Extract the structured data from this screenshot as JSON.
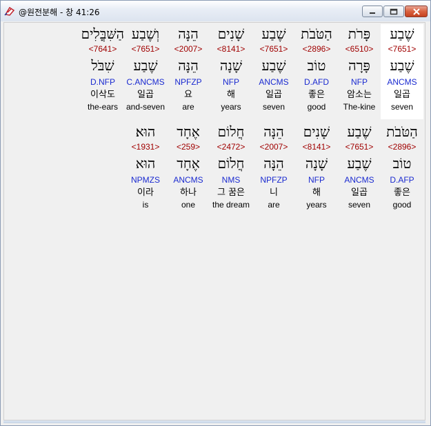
{
  "window": {
    "title": "@원전분해 - 창 41:26"
  },
  "verse": {
    "rows": [
      {
        "cells": [
          {
            "hebrew": "הַשִּׁבֳּלִים",
            "strong": "<7641>",
            "lemma": "שִׁבֹּל",
            "morph": "D.NFP",
            "korean": "이삭도",
            "english": "the-ears"
          },
          {
            "hebrew": "וְשֶׁבַע",
            "strong": "<7651>",
            "lemma": "שֶׁבַע",
            "morph": "C.ANCMS",
            "korean": "일곱",
            "english": "and-seven"
          },
          {
            "hebrew": "הֵנָּה",
            "strong": "<2007>",
            "lemma": "הֵנָּה",
            "morph": "NPFZP",
            "korean": "요",
            "english": "are"
          },
          {
            "hebrew": "שָׁנִים",
            "strong": "<8141>",
            "lemma": "שָׁנָה",
            "morph": "NFP",
            "korean": "해",
            "english": "years"
          },
          {
            "hebrew": "שֶׁבַע",
            "strong": "<7651>",
            "lemma": "שֶׁבַע",
            "morph": "ANCMS",
            "korean": "일곱",
            "english": "seven"
          },
          {
            "hebrew": "הַטֹּבֹת",
            "strong": "<2896>",
            "lemma": "טוֹב",
            "morph": "D.AFD",
            "korean": "좋은",
            "english": "good"
          },
          {
            "hebrew": "פָּרֹת",
            "strong": "<6510>",
            "lemma": "פָּרָה",
            "morph": "NFP",
            "korean": "암소는",
            "english": "The-kine"
          },
          {
            "hebrew": "שֶׁבַע",
            "strong": "<7651>",
            "lemma": "שֶׁבַע",
            "morph": "ANCMS",
            "korean": "일곱",
            "english": "seven"
          }
        ]
      },
      {
        "cells": [
          {
            "hebrew": "הוּא׃",
            "strong": "<1931>",
            "lemma": "הוּא",
            "morph": "NPMZS",
            "korean": "이라",
            "english": "is"
          },
          {
            "hebrew": "אֶחָד",
            "strong": "<259>",
            "lemma": "אֶחָד",
            "morph": "ANCMS",
            "korean": "하나",
            "english": "one"
          },
          {
            "hebrew": "חֲלוֹם",
            "strong": "<2472>",
            "lemma": "חֲלוֹם",
            "morph": "NMS",
            "korean": "그 꿈은",
            "english": "the dream"
          },
          {
            "hebrew": "הֵנָּה",
            "strong": "<2007>",
            "lemma": "הֵנָּה",
            "morph": "NPFZP",
            "korean": "니",
            "english": "are"
          },
          {
            "hebrew": "שָׁנִים",
            "strong": "<8141>",
            "lemma": "שָׁנָה",
            "morph": "NFP",
            "korean": "해",
            "english": "years"
          },
          {
            "hebrew": "שֶׁבַע",
            "strong": "<7651>",
            "lemma": "שֶׁבַע",
            "morph": "ANCMS",
            "korean": "일곱",
            "english": "seven"
          },
          {
            "hebrew": "הַטֹּבֹת",
            "strong": "<2896>",
            "lemma": "טוֹב",
            "morph": "D.AFP",
            "korean": "좋은",
            "english": "good"
          }
        ]
      }
    ]
  }
}
